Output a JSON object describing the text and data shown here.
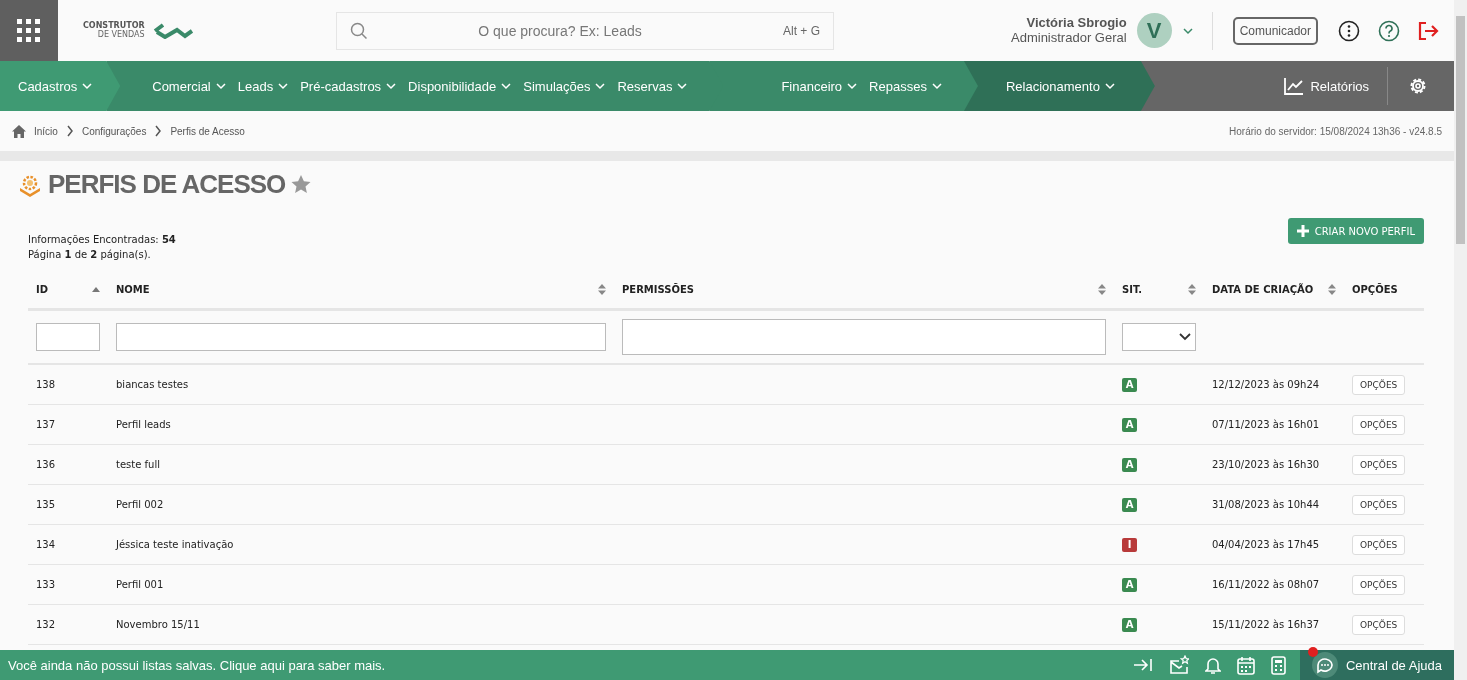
{
  "header": {
    "logo_line1": "CONSTRUTOR",
    "logo_line2": "DE VENDAS",
    "search": {
      "placeholder": "O que procura? Ex: Leads",
      "shortcut": "Alt + G"
    },
    "user": {
      "name": "Victória Sbrogio",
      "role": "Administrador Geral",
      "initial": "V"
    },
    "communicator": "Comunicador"
  },
  "nav": {
    "sections": [
      {
        "color": "#3f9a73",
        "items": [
          "Cadastros"
        ]
      },
      {
        "color": "#3a8a69",
        "items": [
          "Comercial",
          "Leads",
          "Pré-cadastros",
          "Disponibilidade",
          "Simulações",
          "Reservas"
        ]
      },
      {
        "color": "#3a8a69",
        "items": [
          "Financeiro",
          "Repasses"
        ]
      },
      {
        "color": "#2f7057",
        "items": [
          "Relacionamento"
        ]
      }
    ],
    "reports": "Relatórios"
  },
  "breadcrumb": [
    "Início",
    "Configurações",
    "Perfis de Acesso"
  ],
  "server_time": "Horário do servidor: 15/08/2024 13h36 - v24.8.5",
  "page": {
    "title": "PERFIS DE ACESSO",
    "favorite": false,
    "found_label": "Informações Encontradas: **54**",
    "pagination": "Página **1** de **2** página(s).",
    "create_button": "CRIAR NOVO PERFIL"
  },
  "table": {
    "columns": [
      {
        "label": "ID",
        "sortable": true,
        "sorted": true
      },
      {
        "label": "NOME",
        "sortable": true,
        "sorted": false
      },
      {
        "label": "PERMISSÕES",
        "sortable": true,
        "sorted": false
      },
      {
        "label": "SIT.",
        "sortable": true,
        "sorted": false
      },
      {
        "label": "DATA DE CRIAÇÃO",
        "sortable": true,
        "sorted": false
      },
      {
        "label": "OPÇÕES",
        "sortable": false
      }
    ],
    "filters": [
      {
        "kind": "text"
      },
      {
        "kind": "text"
      },
      {
        "kind": "textarea"
      },
      {
        "kind": "select"
      },
      {
        "kind": "blank"
      },
      {
        "kind": "blank"
      }
    ],
    "rows": [
      {
        "id": "138",
        "name": "biancas testes",
        "status": "A",
        "active": true,
        "created": "12/12/2023 às 09h24",
        "options": "OPÇÕES"
      },
      {
        "id": "137",
        "name": "Perfil leads",
        "status": "A",
        "active": true,
        "created": "07/11/2023 às 16h01",
        "options": "OPÇÕES"
      },
      {
        "id": "136",
        "name": "teste full",
        "status": "A",
        "active": true,
        "created": "23/10/2023 às 16h30",
        "options": "OPÇÕES"
      },
      {
        "id": "135",
        "name": "Perfil 002",
        "status": "A",
        "active": true,
        "created": "31/08/2023 às 10h44",
        "options": "OPÇÕES"
      },
      {
        "id": "134",
        "name": "Jéssica teste inativação",
        "status": "I",
        "active": false,
        "created": "04/04/2023 às 17h45",
        "options": "OPÇÕES"
      },
      {
        "id": "133",
        "name": "Perfil 001",
        "status": "A",
        "active": true,
        "created": "16/11/2022 às 08h07",
        "options": "OPÇÕES"
      },
      {
        "id": "132",
        "name": "Novembro 15/11",
        "status": "A",
        "active": true,
        "created": "15/11/2022 às 16h37",
        "options": "OPÇÕES"
      }
    ]
  },
  "footer": {
    "message": "Você ainda não possui listas salvas. Clique aqui para saber mais.",
    "help": "Central de Ajuda",
    "help_notification": true
  }
}
